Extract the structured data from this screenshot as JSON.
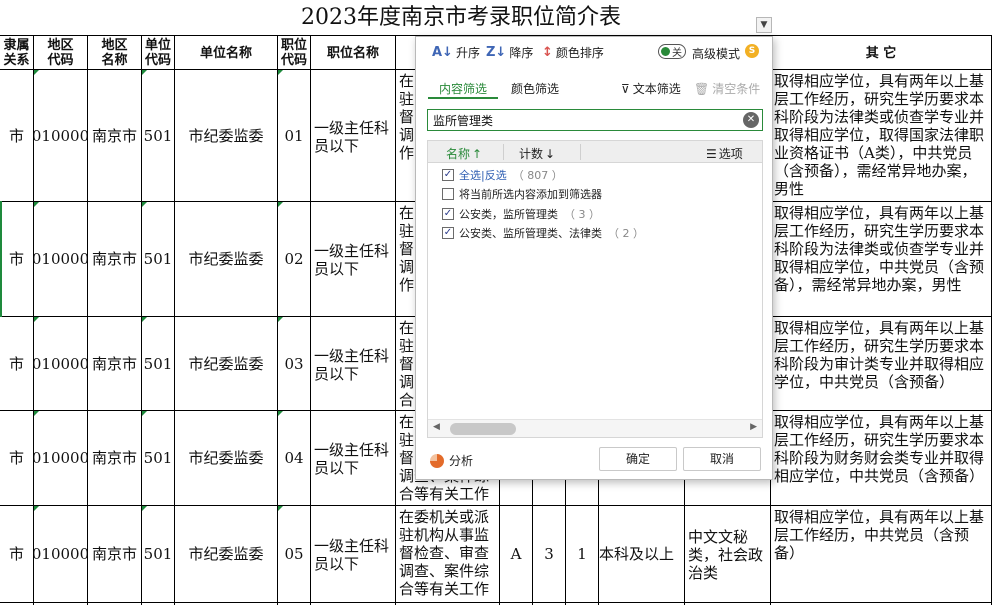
{
  "sheet": {
    "title": "2023年度南京市考录职位简介表",
    "headers": [
      "隶属\n关系",
      "地区\n代码",
      "地区\n名称",
      "单位\n代码",
      "单位名称",
      "职位\n代码",
      "职位名称",
      "其 它"
    ],
    "rows": [
      {
        "rel": "市",
        "area_code": "010000",
        "area_name": "南京市",
        "unit_code": "501",
        "unit_name": "市纪委监委",
        "pos_code": "01",
        "pos_name": "一级主任科员以下",
        "desc_clip": "在\n驻\n督\n调\n作",
        "other": "取得相应学位，具有两年以上基层工作经历，研究生学历要求本科阶段为法律类或侦查学专业并取得相应学位，取得国家法律职业资格证书（A类），中共党员（含预备），需经常异地办案，男性"
      },
      {
        "rel": "市",
        "area_code": "010000",
        "area_name": "南京市",
        "unit_code": "501",
        "unit_name": "市纪委监委",
        "pos_code": "02",
        "pos_name": "一级主任科员以下",
        "desc_clip": "在\n驻\n督\n调\n作",
        "other": "取得相应学位，具有两年以上基层工作经历，研究生学历要求本科阶段为法律类或侦查学专业并取得相应学位，中共党员（含预备），需经常异地办案，男性"
      },
      {
        "rel": "市",
        "area_code": "010000",
        "area_name": "南京市",
        "unit_code": "501",
        "unit_name": "市纪委监委",
        "pos_code": "03",
        "pos_name": "一级主任科员以下",
        "desc_clip": "在\n驻\n督\n调\n合",
        "other": "取得相应学位，具有两年以上基层工作经历，研究生学历要求本科阶段为审计类专业并取得相应学位，中共党员（含预备）"
      },
      {
        "rel": "市",
        "area_code": "010000",
        "area_name": "南京市",
        "unit_code": "501",
        "unit_name": "市纪委监委",
        "pos_code": "04",
        "pos_name": "一级主任科员以下",
        "desc_clip": "在\n驻\n督\n调查、案件综\n合等有关工作",
        "other": "取得相应学位，具有两年以上基层工作经历，研究生学历要求本科阶段为财务财会类专业并取得相应学位，中共党员（含预备）"
      },
      {
        "rel": "市",
        "area_code": "010000",
        "area_name": "南京市",
        "unit_code": "501",
        "unit_name": "市纪委监委",
        "pos_code": "05",
        "pos_name": "一级主任科员以下",
        "desc_clip": "在委机关或派驻机构从事监督检查、审查调查、案件综合等有关工作",
        "cat": "A",
        "num": "3",
        "num2": "1",
        "edu": "本科及以上",
        "major": "中文文秘类，社会政治类",
        "other": "取得相应学位，具有两年以上基层工作经历，中共党员（含预备）"
      }
    ]
  },
  "filter": {
    "toolbar": {
      "asc": "升序",
      "desc": "降序",
      "color_sort": "颜色排序",
      "toggle_state": "关",
      "advanced": "高级模式"
    },
    "tabs": {
      "content": "内容筛选",
      "color": "颜色筛选",
      "text_filter": "文本筛选",
      "clear": "清空条件"
    },
    "search": {
      "value": "监所管理类"
    },
    "list_header": {
      "name": "名称",
      "count": "计数",
      "options": "选项"
    },
    "items": [
      {
        "select_all": "全选",
        "sep": "|",
        "invert": "反选",
        "count": "（ 807 ）",
        "checked": true
      },
      {
        "label": "将当前所选内容添加到筛选器",
        "count": "",
        "checked": false
      },
      {
        "label": "公安类，监所管理类",
        "count": "（ 3 ）",
        "checked": true
      },
      {
        "label": "公安类、监所管理类、法律类",
        "count": "（ 2 ）",
        "checked": true
      }
    ],
    "footer": {
      "analysis": "分析",
      "ok": "确定",
      "cancel": "取消"
    }
  }
}
